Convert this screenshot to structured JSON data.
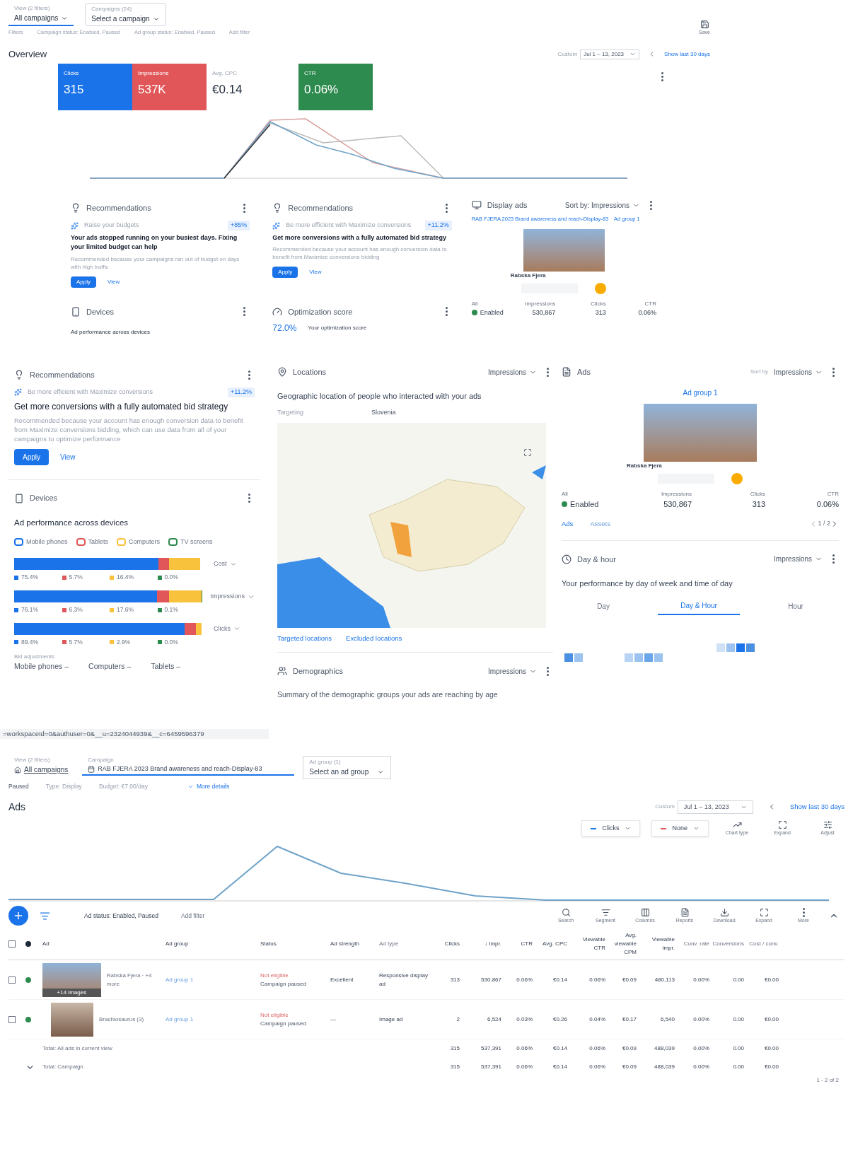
{
  "overview": {
    "scope": {
      "label": "View (2 filters)",
      "value": "All campaigns"
    },
    "campaign": {
      "label": "Campaigns (24)",
      "value": "Select a campaign"
    },
    "save": "Save",
    "filters": [
      "Filters",
      "Campaign status: Enabled, Paused",
      "Ad group status: Enabled, Paused",
      "Add filter"
    ],
    "title": "Overview",
    "date_label": "Custom",
    "date": "Jul 1 – 13, 2023",
    "show_last": "Show last 30 days",
    "metrics": [
      {
        "label": "Clicks",
        "value": "315",
        "selected": true,
        "color": "#1a73e8"
      },
      {
        "label": "Impressions",
        "value": "537K",
        "selected": true,
        "color": "#e15759"
      },
      {
        "label": "Avg. CPC",
        "value": "€0.14",
        "selected": false
      },
      {
        "label": "CTR",
        "value": "0.06%",
        "selected": true,
        "color": "#2e8b4f"
      }
    ],
    "recommendations": [
      {
        "title": "Recommendations",
        "tip": "Raise your budgets",
        "uplift": "+85%",
        "heading": "Your ads stopped running on your busiest days. Fixing your limited budget can help",
        "body": "Recommended because your campaigns ran out of budget on days with high traffic",
        "apply": "Apply",
        "view": "View"
      },
      {
        "title": "Recommendations",
        "tip": "Be more efficient with Maximize conversions",
        "uplift": "+11.2%",
        "heading": "Get more conversions with a fully automated bid strategy",
        "body": "Recommended because your account has enough conversion data to benefit from Maximize conversions bidding",
        "apply": "Apply",
        "view": "View"
      }
    ],
    "display_ads": {
      "title": "Display ads",
      "sort": "Sort by: Impressions",
      "campaign": "RAB FJERA 2023 Brand awareness and reach-Display-83",
      "ad_group": "Ad group 1",
      "ad_name": "Rabska Fjera",
      "columns": [
        "All",
        "Impressions",
        "Clicks",
        "CTR"
      ],
      "status": "Enabled",
      "values": [
        "530,867",
        "313",
        "0.06%"
      ]
    },
    "devices": {
      "title": "Devices",
      "subtitle": "Ad performance across devices"
    },
    "optimization": {
      "title": "Optimization score",
      "score": "72.0%",
      "label": "Your optimization score"
    }
  },
  "dashboard": {
    "recommendation": {
      "title": "Recommendations",
      "tip": "Be more efficient with Maximize conversions",
      "uplift": "+11.2%",
      "heading": "Get more conversions with a fully automated bid strategy",
      "body": "Recommended because your account has enough conversion data to benefit from Maximize conversions bidding, which can use data from all of your campaigns to optimize performance",
      "apply": "Apply",
      "view": "View"
    },
    "devices": {
      "title": "Devices",
      "subtitle": "Ad performance across devices",
      "legend": [
        {
          "label": "Mobile phones",
          "color": "#1a73e8"
        },
        {
          "label": "Tablets",
          "color": "#e15759"
        },
        {
          "label": "Computers",
          "color": "#f9c23c"
        },
        {
          "label": "TV screens",
          "color": "#2e8b4f"
        }
      ],
      "rows": [
        {
          "metric": "Cost",
          "segments": [
            {
              "reading": "75.4%"
            },
            {
              "reading": "5.7%"
            },
            {
              "reading": "16.4%"
            },
            {
              "reading": "0.0%"
            }
          ]
        },
        {
          "metric": "Impressions",
          "segments": [
            {
              "reading": "76.1%"
            },
            {
              "reading": "6.3%"
            },
            {
              "reading": "17.6%"
            },
            {
              "reading": "0.1%"
            }
          ]
        },
        {
          "metric": "Clicks",
          "segments": [
            {
              "reading": "89.4%"
            },
            {
              "reading": "5.7%"
            },
            {
              "reading": "2.9%"
            },
            {
              "reading": "0.0%"
            }
          ]
        }
      ],
      "bid_label": "Bid adjustments",
      "bids": [
        "Mobile phones –",
        "Computers –",
        "Tablets –"
      ]
    },
    "status_url": "=workspaceId=0&authuser=0&__u=2324044939&__c=6459596379",
    "locations": {
      "title": "Locations",
      "metric": "Impressions",
      "subtitle": "Geographic location of people who interacted with your ads",
      "targeting_label": "Targeting",
      "targeting": "Slovenia",
      "links": [
        "Targeted locations",
        "Excluded locations"
      ]
    },
    "demographics": {
      "title": "Demographics",
      "metric": "Impressions",
      "subtitle": "Summary of the demographic groups your ads are reaching by age"
    },
    "ads": {
      "title": "Ads",
      "sort_label": "Sort by",
      "metric": "Impressions",
      "ad_group": "Ad group 1",
      "ad_name": "Rabska Fjera",
      "columns": [
        "All",
        "Impressions",
        "Clicks",
        "CTR"
      ],
      "status": "Enabled",
      "values": [
        "530,867",
        "313",
        "0.06%"
      ],
      "tabs": [
        {
          "label": "Ads",
          "selected": true
        },
        {
          "label": "Assets",
          "selected": false
        }
      ],
      "pager": "1 / 2"
    },
    "day_hour": {
      "title": "Day & hour",
      "metric": "Impressions",
      "subtitle": "Your performance by day of week and time of day",
      "tabs": [
        {
          "label": "Day",
          "selected": false
        },
        {
          "label": "Day & Hour",
          "selected": true
        },
        {
          "label": "Hour",
          "selected": false
        }
      ]
    }
  },
  "ads_page": {
    "scope": {
      "label": "View (2 filters)",
      "value": "All campaigns"
    },
    "campaign": {
      "label": "Campaign",
      "value": "RAB FJERA 2023 Brand awareness and reach-Display-83"
    },
    "ad_group": {
      "label": "Ad group (1)",
      "value": "Select an ad group"
    },
    "info": [
      "Paused",
      "Type: Display",
      "Budget: €7.00/day"
    ],
    "more": "More details",
    "title": "Ads",
    "date_label": "Custom",
    "date": "Jul 1 – 13, 2023",
    "show_last": "Show last 30 days",
    "series": [
      {
        "label": "Clicks",
        "color": "#1a73e8"
      },
      {
        "label": "None",
        "color": "#e15759"
      }
    ],
    "chart_tools": [
      "Chart type",
      "Expand",
      "Adjust"
    ],
    "filter": "Ad status: Enabled, Paused",
    "add_filter": "Add filter",
    "tools": [
      "Search",
      "Segment",
      "Columns",
      "Reports",
      "Download",
      "Expand",
      "More"
    ],
    "all_checked": false,
    "columns": [
      "Ad",
      "Ad group",
      "Status",
      "Ad strength",
      "Ad type",
      "Clicks",
      "↓ Impr.",
      "CTR",
      "Avg. CPC",
      "Viewable CTR",
      "Avg. viewable CPM",
      "Viewable impr.",
      "Conv. rate",
      "Conversions",
      "Cost / conv."
    ],
    "rows": [
      {
        "checked": false,
        "color": "#2e8b4f",
        "thumb": "+14 images",
        "status_note": "Campaign paused",
        "cells": [
          "Rabska Fjera · +4 more",
          "Ad group 1",
          "Not eligible",
          "Excellent",
          "Responsive display ad",
          "313",
          "530,867",
          "0.06%",
          "€0.14",
          "0.06%",
          "€0.09",
          "480,113",
          "0.00%",
          "0.00",
          "€0.00"
        ]
      },
      {
        "checked": false,
        "color": "#2e8b4f",
        "status_note": "Campaign paused",
        "cells": [
          "Brachiosaurus (3)",
          "Ad group 1",
          "Not eligible",
          "—",
          "Image ad",
          "2",
          "6,524",
          "0.03%",
          "€0.26",
          "0.04%",
          "€0.17",
          "6,540",
          "0.00%",
          "0.00",
          "€0.00"
        ]
      }
    ],
    "totals": [
      {
        "kind": "view",
        "cells": [
          "Total: All ads in current view",
          "",
          "",
          "",
          "",
          "315",
          "537,391",
          "0.06%",
          "€0.14",
          "0.06%",
          "€0.09",
          "488,039",
          "0.00%",
          "0.00",
          "€0.00"
        ]
      },
      {
        "kind": "campaign",
        "cells": [
          "Total: Campaign",
          "",
          "",
          "",
          "",
          "315",
          "537,391",
          "0.06%",
          "€0.14",
          "0.06%",
          "€0.09",
          "488,039",
          "0.00%",
          "0.00",
          "€0.00"
        ]
      }
    ],
    "pager": "1 - 2 of 2"
  }
}
